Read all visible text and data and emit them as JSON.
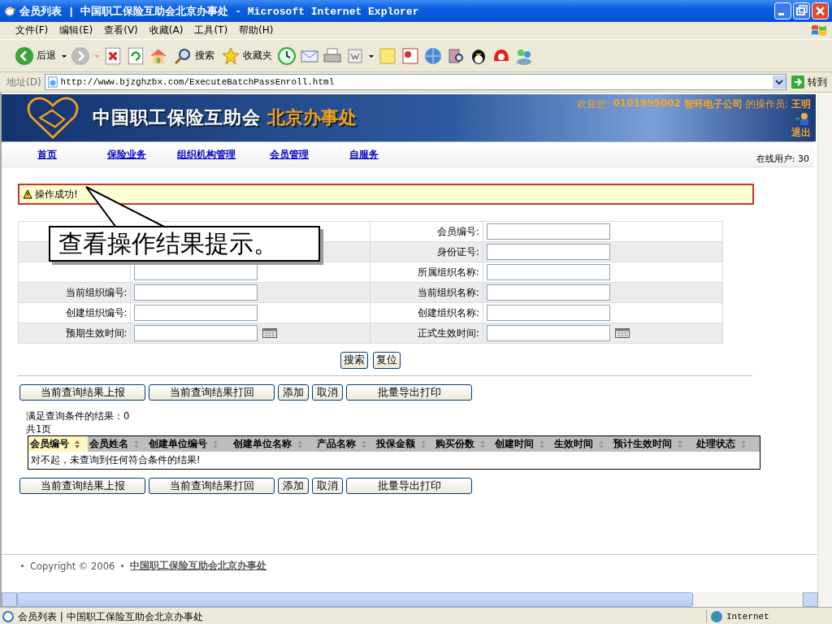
{
  "window": {
    "title": "会员列表 | 中国职工保险互助会北京办事处 - Microsoft Internet Explorer"
  },
  "menu": [
    "文件(F)",
    "编辑(E)",
    "查看(V)",
    "收藏(A)",
    "工具(T)",
    "帮助(H)"
  ],
  "toolbar": {
    "back": "后退",
    "search": "搜索",
    "favorites": "收藏夹"
  },
  "address": {
    "label": "地址(D)",
    "url": "http://www.bjzghzbx.com/ExecuteBatchPassEnroll.html",
    "go": "转到"
  },
  "banner": {
    "title": "中国职工保险互助会",
    "office": "北京办事处",
    "welcome": "欢迎您:",
    "code": "0101999002",
    "company": "智环电子公司",
    "operator_label": "的操作员:",
    "user": "王明",
    "logout": "退出"
  },
  "nav": {
    "items": [
      "首页",
      "保险业务",
      "组织机构管理",
      "会员管理",
      "自服务"
    ],
    "online": "在线用户: 30"
  },
  "alert": {
    "message": "操作成功!"
  },
  "callout": {
    "text": "查看操作结果提示。"
  },
  "form": {
    "rows": [
      {
        "right": {
          "label": "会员编号:"
        }
      },
      {
        "right": {
          "label": "身份证号:"
        }
      },
      {
        "left": {},
        "right": {
          "label": "所属组织名称:"
        }
      },
      {
        "left": {
          "label": "当前组织编号:"
        },
        "right": {
          "label": "当前组织名称:"
        }
      },
      {
        "left": {
          "label": "创建组织编号:"
        },
        "right": {
          "label": "创建组织名称:"
        }
      },
      {
        "left": {
          "label": "预期生效时间:",
          "calendar": true
        },
        "right": {
          "label": "正式生效时间:",
          "calendar": true
        }
      }
    ],
    "buttons": [
      "搜索",
      "复位"
    ]
  },
  "actions_top": [
    "当前查询结果上报",
    "当前查询结果打回",
    "添加",
    "取消",
    "批量导出打印"
  ],
  "result_count": "满足查询条件的结果：0",
  "pages": "共1页",
  "table": {
    "columns": [
      {
        "label": "会员编号",
        "selected": true
      },
      {
        "label": "会员姓名",
        "selected": false
      },
      {
        "label": "创建单位编号",
        "selected": false
      },
      {
        "label": "创建单位名称",
        "selected": false
      },
      {
        "label": "产品名称",
        "selected": false
      },
      {
        "label": "投保金额",
        "selected": false
      },
      {
        "label": "购买份数",
        "selected": false
      },
      {
        "label": "创建时间",
        "selected": false
      },
      {
        "label": "生效时间",
        "selected": false
      },
      {
        "label": "预计生效时间",
        "selected": false
      },
      {
        "label": "处理状态",
        "selected": false
      }
    ],
    "empty_message": "对不起，未查询到任何符合条件的结果!"
  },
  "actions_bottom": [
    "当前查询结果上报",
    "当前查询结果打回",
    "添加",
    "取消",
    "批量导出打印"
  ],
  "footer": {
    "copyright": "Copyright © 2006",
    "link": "中国职工保险互助会北京办事处"
  },
  "status_bar": {
    "text": "会员列表 | 中国职工保险互助会北京办事处",
    "zone": "Internet"
  }
}
